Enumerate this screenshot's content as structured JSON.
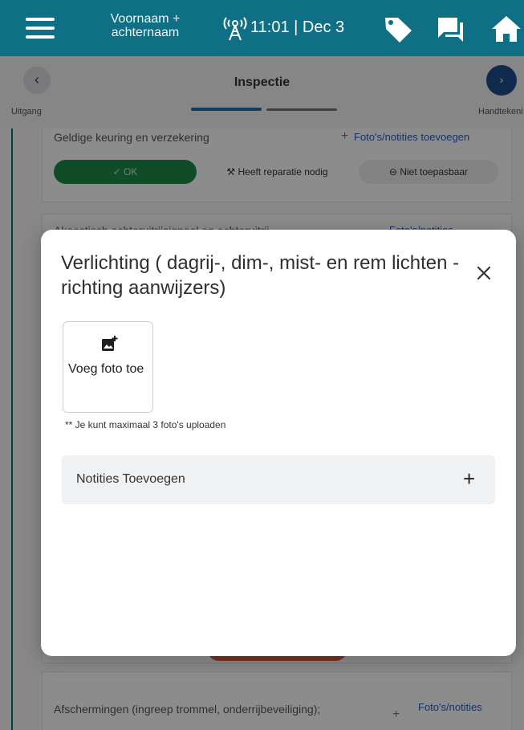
{
  "topbar": {
    "user_name": "Voornaam + achternaam",
    "clock": "11:01 | Dec 3",
    "icons": [
      "menu-icon",
      "signal-tower-icon",
      "tag-icon",
      "chat-icon",
      "home-icon"
    ],
    "background_color": "#0e6f85"
  },
  "step": {
    "title": "Inspectie",
    "back_glyph": "‹",
    "next_glyph": "›",
    "exit_label": "Uitgang",
    "sign_label": "Handtekeni"
  },
  "background": {
    "card1": {
      "title": "Geldige keuring en verzekering",
      "link": "Foto's/notities toevoegen",
      "plus": "+"
    },
    "card2": {
      "title": "Akoestisch achteruitrijsignaal en achteruitrij",
      "link": "Foto's/notities"
    },
    "card3": {
      "title": "Afschermingen (ingreep trommel, onderrijbeveiliging);",
      "link": "Foto's/notities",
      "plus": "+"
    },
    "ok_label": "OK",
    "repair_label": "Heeft reparatie nodig",
    "na_label": "Niet toepasbaar",
    "check_glyph": "✓",
    "minus_glyph": "⊖"
  },
  "modal": {
    "title": "Verlichting ( dagrij-, dim-, mist- en rem lichten - richting aanwijzers)",
    "add_photo_label": "Voeg foto toe",
    "upload_note": "** Je kunt maximaal 3 foto's uploaden",
    "notes_label": "Notities Toevoegen",
    "notes_plus": "+"
  }
}
